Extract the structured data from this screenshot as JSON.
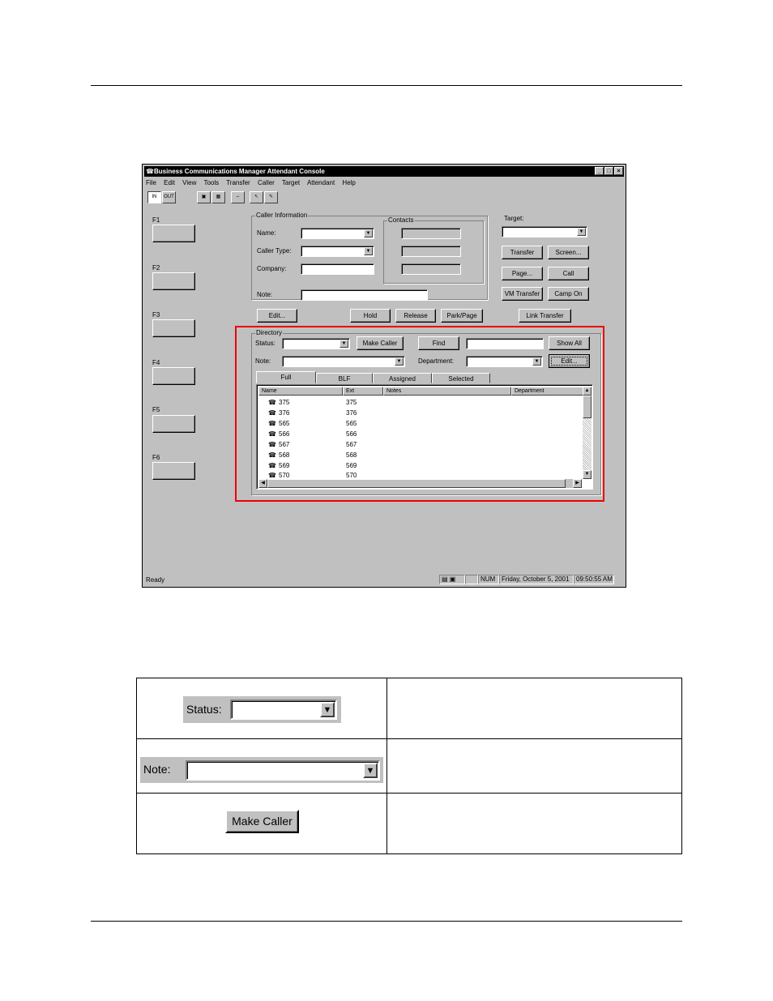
{
  "window": {
    "title": "Business Communications Manager Attendant Console",
    "title_icon": "phone-icon",
    "controls": [
      "_",
      "□",
      "×"
    ]
  },
  "menu": [
    "File",
    "Edit",
    "View",
    "Tools",
    "Transfer",
    "Caller",
    "Target",
    "Attendant",
    "Help"
  ],
  "toolbar": {
    "in_label": "IN",
    "out_label": "OUT"
  },
  "fkeys": [
    "F1",
    "F2",
    "F3",
    "F4",
    "F5",
    "F6"
  ],
  "caller_info": {
    "title": "Caller Information",
    "name_label": "Name:",
    "caller_type_label": "Caller Type:",
    "company_label": "Company:",
    "note_label": "Note:",
    "contacts_title": "Contacts",
    "edit_button": "Edit...",
    "hold_button": "Hold",
    "release_button": "Release",
    "park_button": "Park/Page"
  },
  "target": {
    "label": "Target:",
    "transfer_button": "Transfer",
    "screen_button": "Screen...",
    "page_button": "Page...",
    "call_button": "Call",
    "vm_transfer_button": "VM Transfer",
    "camp_on_button": "Camp On",
    "link_transfer_button": "Link Transfer"
  },
  "directory": {
    "title": "Directory",
    "status_label": "Status:",
    "make_caller_button": "Make Caller",
    "find_button": "Find",
    "show_all_button": "Show All",
    "note_label": "Note:",
    "department_label": "Department:",
    "edit_button": "Edit...",
    "tabs": [
      "Full",
      "BLF",
      "Assigned",
      "Selected"
    ],
    "columns": [
      "Name",
      "Ext",
      "Notes",
      "Department"
    ],
    "rows": [
      {
        "name": "375",
        "ext": "375"
      },
      {
        "name": "376",
        "ext": "376"
      },
      {
        "name": "565",
        "ext": "565"
      },
      {
        "name": "566",
        "ext": "566"
      },
      {
        "name": "567",
        "ext": "567"
      },
      {
        "name": "568",
        "ext": "568"
      },
      {
        "name": "569",
        "ext": "569"
      },
      {
        "name": "570",
        "ext": "570"
      }
    ]
  },
  "statusbar": {
    "ready": "Ready",
    "num": "NUM",
    "date": "Friday, October 5, 2001",
    "time": "09:50:55 AM"
  },
  "table": {
    "status_label": "Status:",
    "note_label": "Note:",
    "make_caller_label": "Make Caller"
  },
  "colors": {
    "highlight": "#e00000",
    "window_face": "#c0c0c0",
    "titlebar": "#000000"
  }
}
